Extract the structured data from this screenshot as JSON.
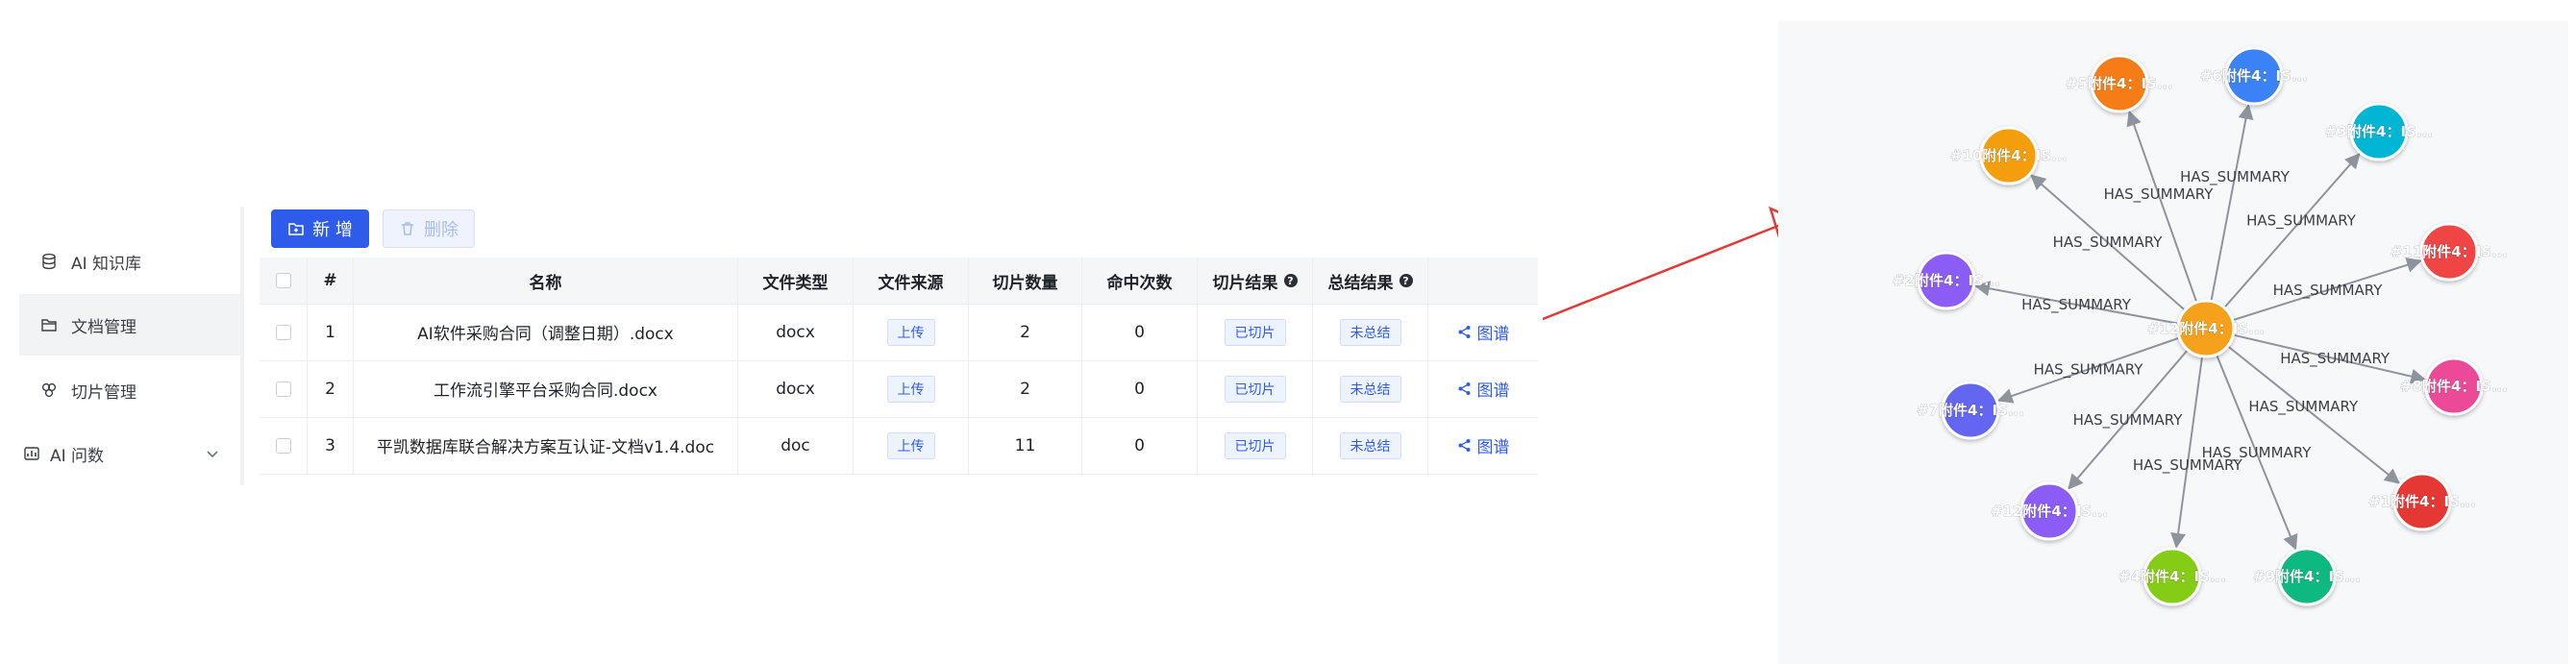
{
  "sidebar": {
    "items": [
      {
        "label": "AI 知识库",
        "icon": "database-icon",
        "active": false
      },
      {
        "label": "文档管理",
        "icon": "folder-icon",
        "active": true
      },
      {
        "label": "切片管理",
        "icon": "slices-icon",
        "active": false
      }
    ],
    "group": {
      "label": "AI 问数",
      "icon": "chart-icon"
    }
  },
  "toolbar": {
    "add_label": "新 增",
    "delete_label": "删除"
  },
  "table": {
    "columns": [
      "#",
      "名称",
      "文件类型",
      "文件来源",
      "切片数量",
      "命中次数",
      "切片结果",
      "总结结果"
    ],
    "rows": [
      {
        "index": "1",
        "name": "AI软件采购合同（调整日期）.docx",
        "type": "docx",
        "source": "上传",
        "slices": "2",
        "hits": "0",
        "slice_result": "已切片",
        "summary_result": "未总结",
        "action": "图谱"
      },
      {
        "index": "2",
        "name": "工作流引擎平台采购合同.docx",
        "type": "docx",
        "source": "上传",
        "slices": "2",
        "hits": "0",
        "slice_result": "已切片",
        "summary_result": "未总结",
        "action": "图谱"
      },
      {
        "index": "3",
        "name": "平凯数据库联合解决方案互认证-文档v1.4.doc",
        "type": "doc",
        "source": "上传",
        "slices": "11",
        "hits": "0",
        "slice_result": "已切片",
        "summary_result": "未总结",
        "action": "图谱"
      }
    ]
  },
  "colors": {
    "primary": "#2f5bea",
    "arrow": "#e53935",
    "edge": "#8f949c",
    "center_node": "#f5a11b"
  },
  "graph": {
    "center": {
      "label": "#12附件4：IS...",
      "color": "#f5a11b"
    },
    "edge_label": "HAS_SUMMARY",
    "nodes": [
      {
        "label": "#5附件4：IS...",
        "color": "#f57c14"
      },
      {
        "label": "#6附件4：IS...",
        "color": "#3b82f6"
      },
      {
        "label": "#3附件4：IS...",
        "color": "#06b6d4"
      },
      {
        "label": "#10附件4：IS...",
        "color": "#f59e0b"
      },
      {
        "label": "#11附件4：IS...",
        "color": "#ef4444"
      },
      {
        "label": "#2附件4：IS...",
        "color": "#8b5cf6"
      },
      {
        "label": "#8附件4：IS...",
        "color": "#ec4899"
      },
      {
        "label": "#7附件4：IS...",
        "color": "#6366f1"
      },
      {
        "label": "#1附件4：IS...",
        "color": "#e53935"
      },
      {
        "label": "#12附件4：IS...",
        "color": "#8b5cf6"
      },
      {
        "label": "#4附件4：IS...",
        "color": "#84cc16"
      },
      {
        "label": "#9附件4：IS...",
        "color": "#10b981"
      }
    ]
  }
}
